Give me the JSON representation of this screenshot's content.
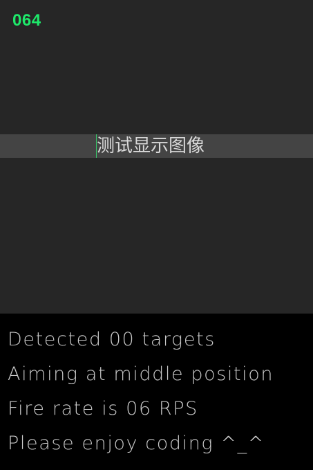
{
  "counter": "064",
  "banner": {
    "text": "测试显示图像"
  },
  "console": {
    "lines": [
      "Detected 00 targets",
      "Aiming at middle position",
      "Fire rate is 06 RPS",
      "Please enjoy coding ^_^"
    ]
  },
  "colors": {
    "counter": "#1ee86a",
    "viewport_bg": "#262626",
    "banner_bg": "#444444",
    "console_bg": "#000000",
    "console_text": "#c8c8c8"
  }
}
